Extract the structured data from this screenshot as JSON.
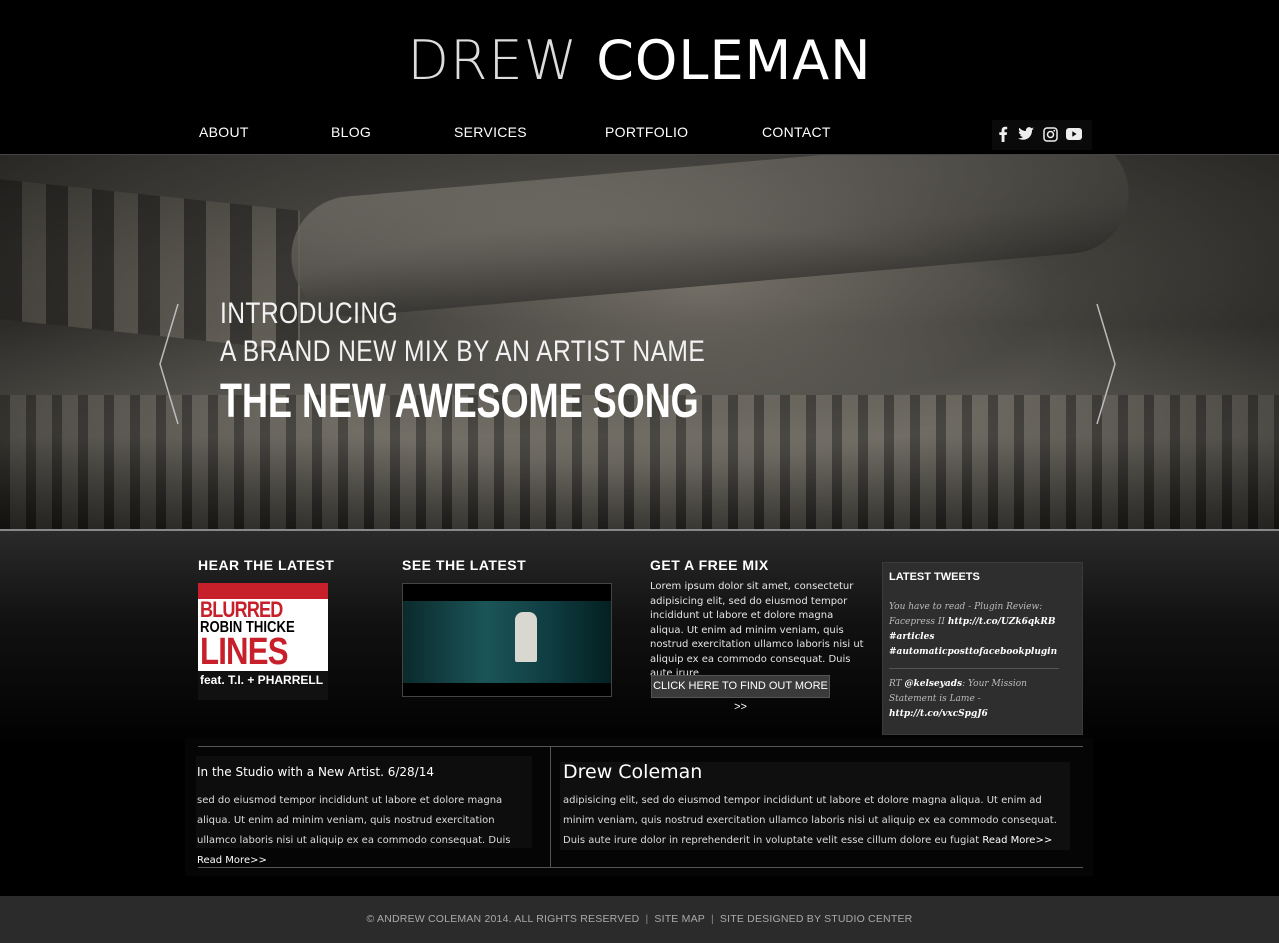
{
  "brand": {
    "first": "DREW",
    "last": "COLEMAN"
  },
  "nav": {
    "about": "ABOUT",
    "blog": "BLOG",
    "services": "SERVICES",
    "portfolio": "PORTFOLIO",
    "contact": "CONTACT"
  },
  "social": {
    "facebook": "f",
    "twitter": "twitter",
    "instagram": "instagram",
    "youtube": "youtube"
  },
  "hero": {
    "line1": "INTRODUCING",
    "line2": "A BRAND NEW MIX BY AN ARTIST NAME",
    "line3": "THE NEW AWESOME SONG"
  },
  "sections": {
    "hear": "HEAR THE LATEST",
    "see": "SEE THE LATEST",
    "free": "GET A FREE MIX",
    "free_text": "Lorem ipsum dolor sit amet, consectetur adipisicing elit, sed do eiusmod tempor incididunt ut labore et dolore magna aliqua. Ut enim ad minim veniam, quis nostrud exercitation ullamco laboris nisi ut aliquip ex ea commodo consequat. Duis aute irure",
    "free_button": "CLICK HERE TO FIND OUT MORE >>"
  },
  "album": {
    "line1": "BLURRED",
    "line2": "ROBIN THICKE",
    "line3": "LINES",
    "line4": "feat. T.I. + PHARRELL"
  },
  "tweets": {
    "title": "LATEST TWEETS",
    "t1_text": "You have to read - Plugin Review: Facepress II",
    "t1_link": "http://t.co/UZk6qkRB",
    "t1_tags": "#articles #automaticposttofacebookplugin",
    "t2_prefix": "RT",
    "t2_user": "@kelseyads",
    "t2_text": ": Your Mission Statement is Lame -",
    "t2_link": "http://t.co/vxcSpgJ6"
  },
  "post": {
    "title": "In the Studio with a New Artist. 6/28/14",
    "body": "sed do eiusmod tempor incididunt ut labore et dolore magna aliqua. Ut enim ad minim veniam, quis nostrud exercitation ullamco laboris nisi ut aliquip ex ea commodo consequat. Duis ",
    "more": "Read More>>"
  },
  "about": {
    "title": "Drew Coleman",
    "body": "adipisicing elit, sed do eiusmod tempor incididunt ut labore et dolore magna aliqua. Ut enim ad minim veniam, quis nostrud exercitation ullamco laboris nisi ut aliquip ex ea commodo consequat. Duis aute irure dolor in reprehenderit in voluptate velit esse cillum dolore eu fugiat ",
    "more": "Read More>>"
  },
  "footer": {
    "copyright": "© ANDREW COLEMAN 2014. ALL RIGHTS RESERVED",
    "sitemap": "SITE MAP",
    "designed": "SITE DESIGNED BY STUDIO CENTER"
  }
}
